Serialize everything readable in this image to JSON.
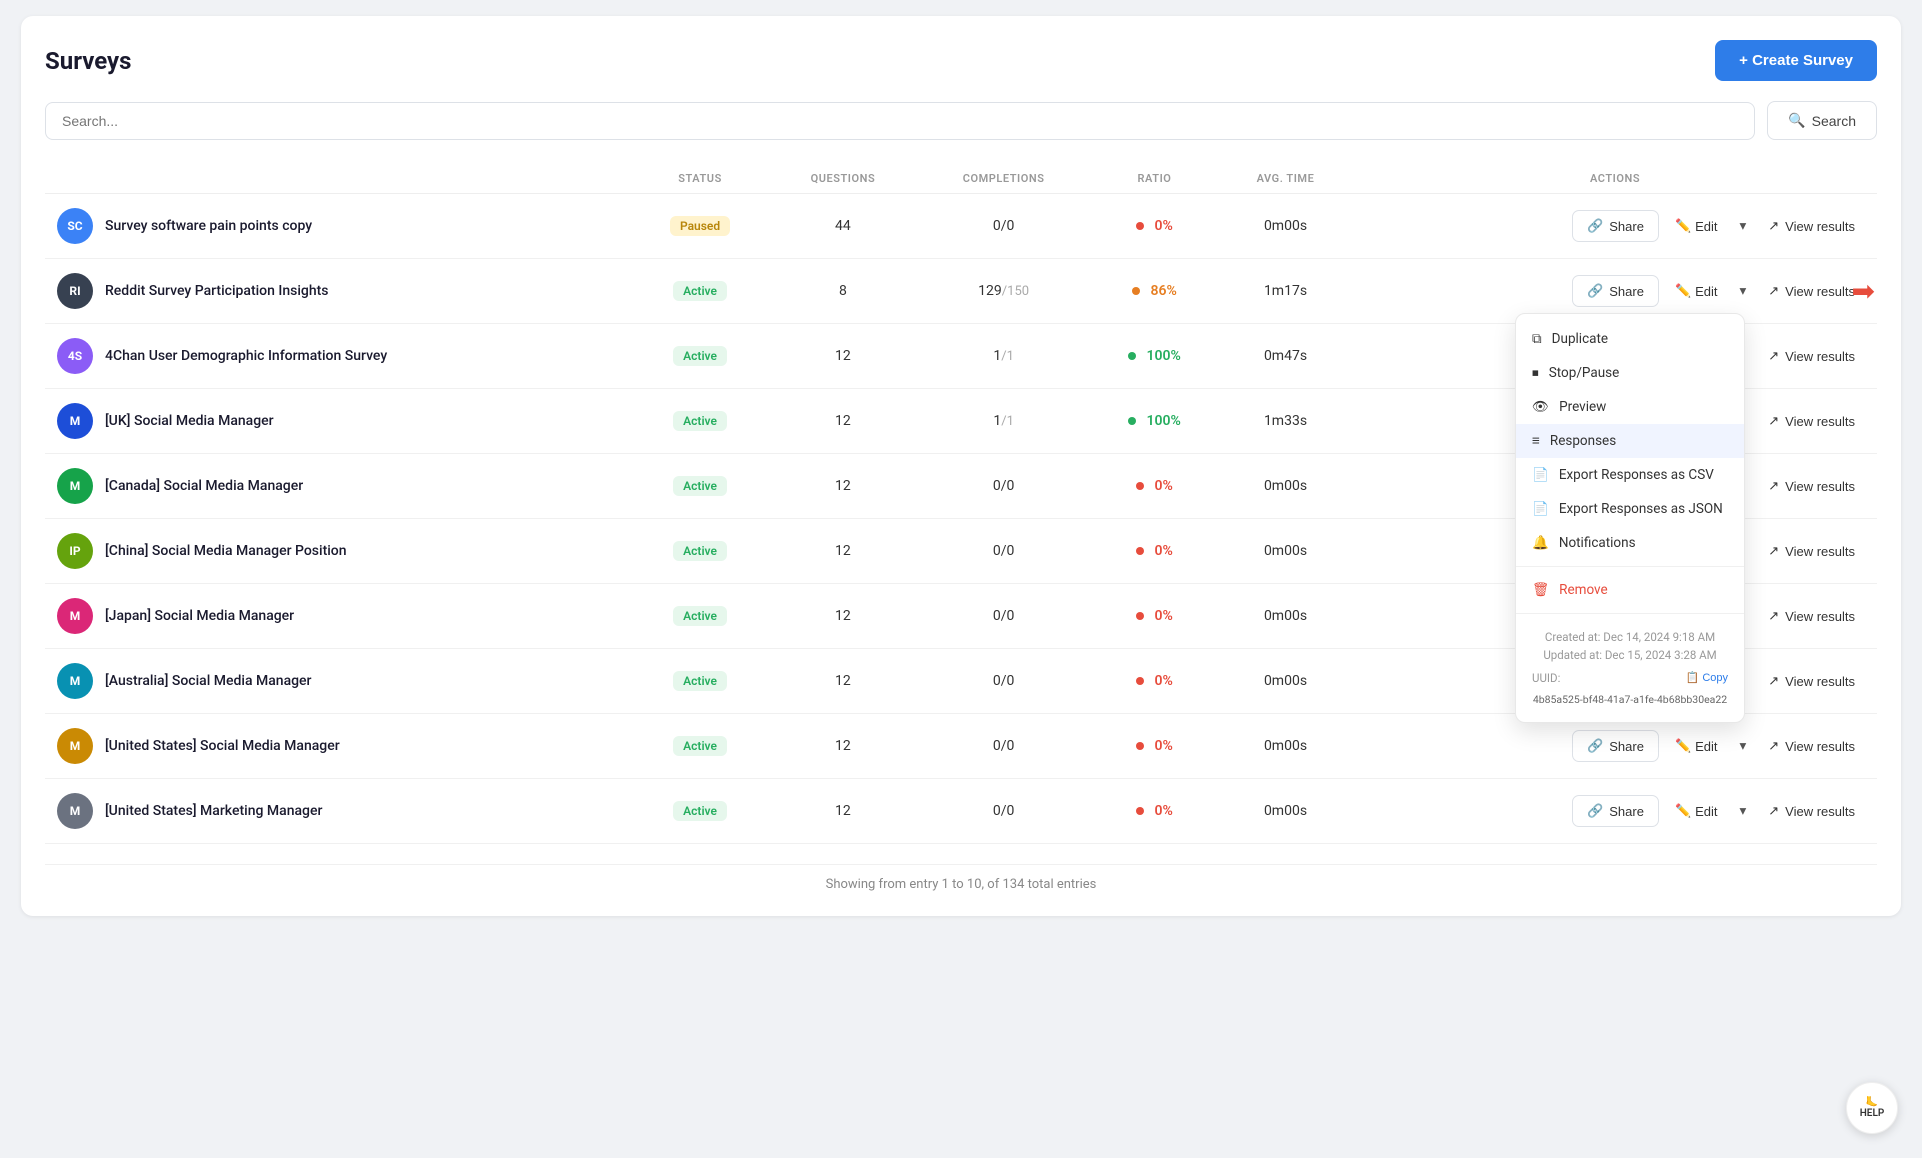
{
  "page": {
    "title": "Surveys",
    "create_btn": "+ Create Survey",
    "search_placeholder": "Search...",
    "search_btn": "Search",
    "footer": "Showing from entry 1 to 10, of 134 total entries"
  },
  "table": {
    "columns": [
      "STATUS",
      "QUESTIONS",
      "COMPLETIONS",
      "RATIO",
      "AVG. TIME",
      "ACTIONS"
    ],
    "rows": [
      {
        "id": 1,
        "avatar_text": "SC",
        "avatar_color": "#3b82f6",
        "name": "Survey software pain points copy",
        "status": "Paused",
        "status_type": "paused",
        "questions": "44",
        "completions": "0",
        "completions_total": "0",
        "has_total": false,
        "dot_type": "red",
        "ratio": "0%",
        "ratio_type": "red",
        "avg_time": "0m00s",
        "show_actions": true,
        "show_dropdown": false
      },
      {
        "id": 2,
        "avatar_text": "RI",
        "avatar_color": "#374151",
        "name": "Reddit Survey Participation Insights",
        "status": "Active",
        "status_type": "active",
        "questions": "8",
        "completions": "129",
        "completions_total": "150",
        "has_total": true,
        "dot_type": "orange",
        "ratio": "86%",
        "ratio_type": "orange",
        "avg_time": "1m17s",
        "show_actions": true,
        "show_dropdown": true
      },
      {
        "id": 3,
        "avatar_text": "4S",
        "avatar_color": "#8b5cf6",
        "name": "4Chan User Demographic Information Survey",
        "status": "Active",
        "status_type": "active",
        "questions": "12",
        "completions": "1",
        "completions_total": "1",
        "has_total": true,
        "dot_type": "green",
        "ratio": "100%",
        "ratio_type": "green",
        "avg_time": "0m47s",
        "show_actions": false,
        "show_dropdown": false
      },
      {
        "id": 4,
        "avatar_text": "M",
        "avatar_color": "#1d4ed8",
        "name": "[UK] Social Media Manager",
        "status": "Active",
        "status_type": "active",
        "questions": "12",
        "completions": "1",
        "completions_total": "1",
        "has_total": true,
        "dot_type": "green",
        "ratio": "100%",
        "ratio_type": "green",
        "avg_time": "1m33s",
        "show_actions": false,
        "show_dropdown": false
      },
      {
        "id": 5,
        "avatar_text": "M",
        "avatar_color": "#16a34a",
        "name": "[Canada] Social Media Manager",
        "status": "Active",
        "status_type": "active",
        "questions": "12",
        "completions": "0",
        "completions_total": "0",
        "has_total": false,
        "dot_type": "red",
        "ratio": "0%",
        "ratio_type": "red",
        "avg_time": "0m00s",
        "show_actions": false,
        "show_dropdown": false
      },
      {
        "id": 6,
        "avatar_text": "IP",
        "avatar_color": "#65a30d",
        "name": "[China] Social Media Manager Position",
        "status": "Active",
        "status_type": "active",
        "questions": "12",
        "completions": "0",
        "completions_total": "0",
        "has_total": false,
        "dot_type": "red",
        "ratio": "0%",
        "ratio_type": "red",
        "avg_time": "0m00s",
        "show_actions": false,
        "show_dropdown": false
      },
      {
        "id": 7,
        "avatar_text": "M",
        "avatar_color": "#db2777",
        "name": "[Japan] Social Media Manager",
        "status": "Active",
        "status_type": "active",
        "questions": "12",
        "completions": "0",
        "completions_total": "0",
        "has_total": false,
        "dot_type": "red",
        "ratio": "0%",
        "ratio_type": "red",
        "avg_time": "0m00s",
        "show_actions": false,
        "show_dropdown": false
      },
      {
        "id": 8,
        "avatar_text": "M",
        "avatar_color": "#0891b2",
        "name": "[Australia] Social Media Manager",
        "status": "Active",
        "status_type": "active",
        "questions": "12",
        "completions": "0",
        "completions_total": "0",
        "has_total": false,
        "dot_type": "red",
        "ratio": "0%",
        "ratio_type": "red",
        "avg_time": "0m00s",
        "show_actions": false,
        "show_dropdown": false
      },
      {
        "id": 9,
        "avatar_text": "M",
        "avatar_color": "#ca8a04",
        "name": "[United States] Social Media Manager",
        "status": "Active",
        "status_type": "active",
        "questions": "12",
        "completions": "0",
        "completions_total": "0",
        "has_total": false,
        "dot_type": "red",
        "ratio": "0%",
        "ratio_type": "red",
        "avg_time": "0m00s",
        "show_actions": true,
        "show_dropdown": false
      },
      {
        "id": 10,
        "avatar_text": "M",
        "avatar_color": "#6b7280",
        "name": "[United States] Marketing Manager",
        "status": "Active",
        "status_type": "active",
        "questions": "12",
        "completions": "0",
        "completions_total": "0",
        "has_total": false,
        "dot_type": "red",
        "ratio": "0%",
        "ratio_type": "red",
        "avg_time": "0m00s",
        "show_actions": true,
        "show_dropdown": false
      }
    ]
  },
  "dropdown": {
    "items": [
      {
        "label": "Duplicate",
        "icon": "⧉",
        "type": "normal"
      },
      {
        "label": "Stop/Pause",
        "icon": "⏹",
        "type": "normal"
      },
      {
        "label": "Preview",
        "icon": "👁",
        "type": "normal"
      },
      {
        "label": "Responses",
        "icon": "≡",
        "type": "highlighted"
      },
      {
        "label": "Export Responses as CSV",
        "icon": "📄",
        "type": "normal"
      },
      {
        "label": "Export Responses as JSON",
        "icon": "📄",
        "type": "normal"
      },
      {
        "label": "Notifications",
        "icon": "🔔",
        "type": "normal"
      },
      {
        "label": "Remove",
        "icon": "🗑",
        "type": "red"
      }
    ],
    "meta_created": "Created at: Dec 14, 2024 9:18 AM",
    "meta_updated": "Updated at: Dec 15, 2024 3:28 AM",
    "uuid_label": "UUID:",
    "uuid_value": "4b85a525-bf48-41a7-a1fe-4b68bb30ea22",
    "copy_btn": "Copy"
  },
  "labels": {
    "share": "Share",
    "edit": "Edit",
    "view_results": "View results"
  }
}
